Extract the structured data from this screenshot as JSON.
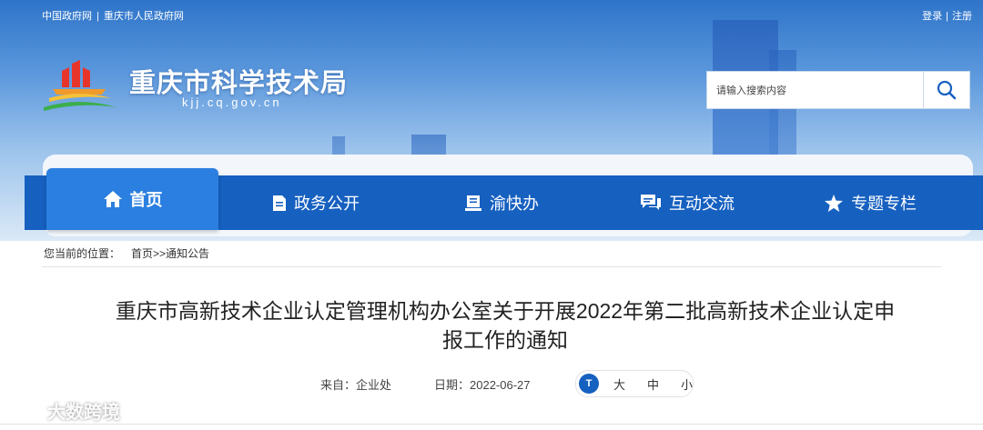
{
  "top_links": {
    "gov": "中国政府网",
    "city_gov": "重庆市人民政府网",
    "separator": "|"
  },
  "user_links": {
    "login": "登录",
    "register": "注册",
    "separator": "|"
  },
  "site": {
    "title": "重庆市科学技术局",
    "domain": "kjj.cq.gov.cn"
  },
  "search": {
    "placeholder": "请输入搜索内容",
    "icon": "search-icon"
  },
  "nav": {
    "active": "首页",
    "items": [
      {
        "label": "首页",
        "icon": "home-icon"
      },
      {
        "label": "政务公开",
        "icon": "document-icon"
      },
      {
        "label": "渝快办",
        "icon": "book-icon"
      },
      {
        "label": "互动交流",
        "icon": "chat-icon"
      },
      {
        "label": "专题专栏",
        "icon": "star-icon"
      }
    ]
  },
  "breadcrumb": {
    "prefix": "您当前的位置：",
    "path": "首页>>通知公告"
  },
  "article": {
    "title_line1": "重庆市高新技术企业认定管理机构办公室关于开展2022年第二批高新技术企业认定申",
    "title_line2": "报工作的通知",
    "source_label": "来自：",
    "source": "企业处",
    "date_label": "日期：",
    "date": "2022-06-27"
  },
  "font_size": {
    "icon_text": "T",
    "large": "大",
    "medium": "中",
    "small": "小"
  },
  "watermark": {
    "text": "大数跨境"
  },
  "colors": {
    "nav_bg": "#1660c0",
    "nav_active": "#2b7fe0",
    "banner_top": "#2e74c9"
  }
}
